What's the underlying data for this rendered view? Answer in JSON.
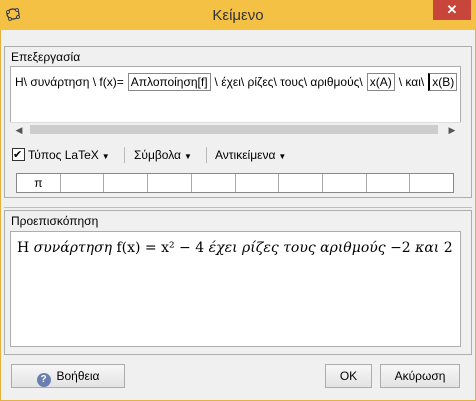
{
  "window": {
    "title": "Κείμενο",
    "close_label": "✕"
  },
  "edit": {
    "section_label": "Επεξεργασία",
    "segments": [
      {
        "type": "text",
        "value": "Η\\  συνάρτηση \\ f(x)="
      },
      {
        "type": "chip",
        "value": "Απλοποίηση[f]"
      },
      {
        "type": "text",
        "value": "\\  έχει\\  ρίζες\\  τους\\  αριθμούς\\"
      },
      {
        "type": "chip",
        "value": "x(A)"
      },
      {
        "type": "text",
        "value": "\\ και\\"
      },
      {
        "type": "chip",
        "value": "x(B)"
      }
    ]
  },
  "toolbar": {
    "latex_label": "Τύπος LaTeX",
    "latex_checked": true,
    "symbols_label": "Σύμβολα",
    "objects_label": "Αντικείμενα"
  },
  "symbol_cells": [
    "π",
    "",
    "",
    "",
    "",
    "",
    "",
    "",
    "",
    ""
  ],
  "preview": {
    "section_label": "Προεπισκόπηση",
    "line": [
      {
        "style": "plain",
        "value": "Η "
      },
      {
        "style": "italic",
        "value": "συνάρτηση"
      },
      {
        "style": "plain",
        "value": " f(x) = x² − 4 "
      },
      {
        "style": "italic",
        "value": "έχει ρίζες τους αριθμούς"
      },
      {
        "style": "plain",
        "value": "  −2 "
      },
      {
        "style": "italic",
        "value": "και"
      },
      {
        "style": "plain",
        "value": " 2"
      }
    ]
  },
  "buttons": {
    "help": "Βοήθεια",
    "ok": "OK",
    "cancel": "Ακύρωση"
  }
}
